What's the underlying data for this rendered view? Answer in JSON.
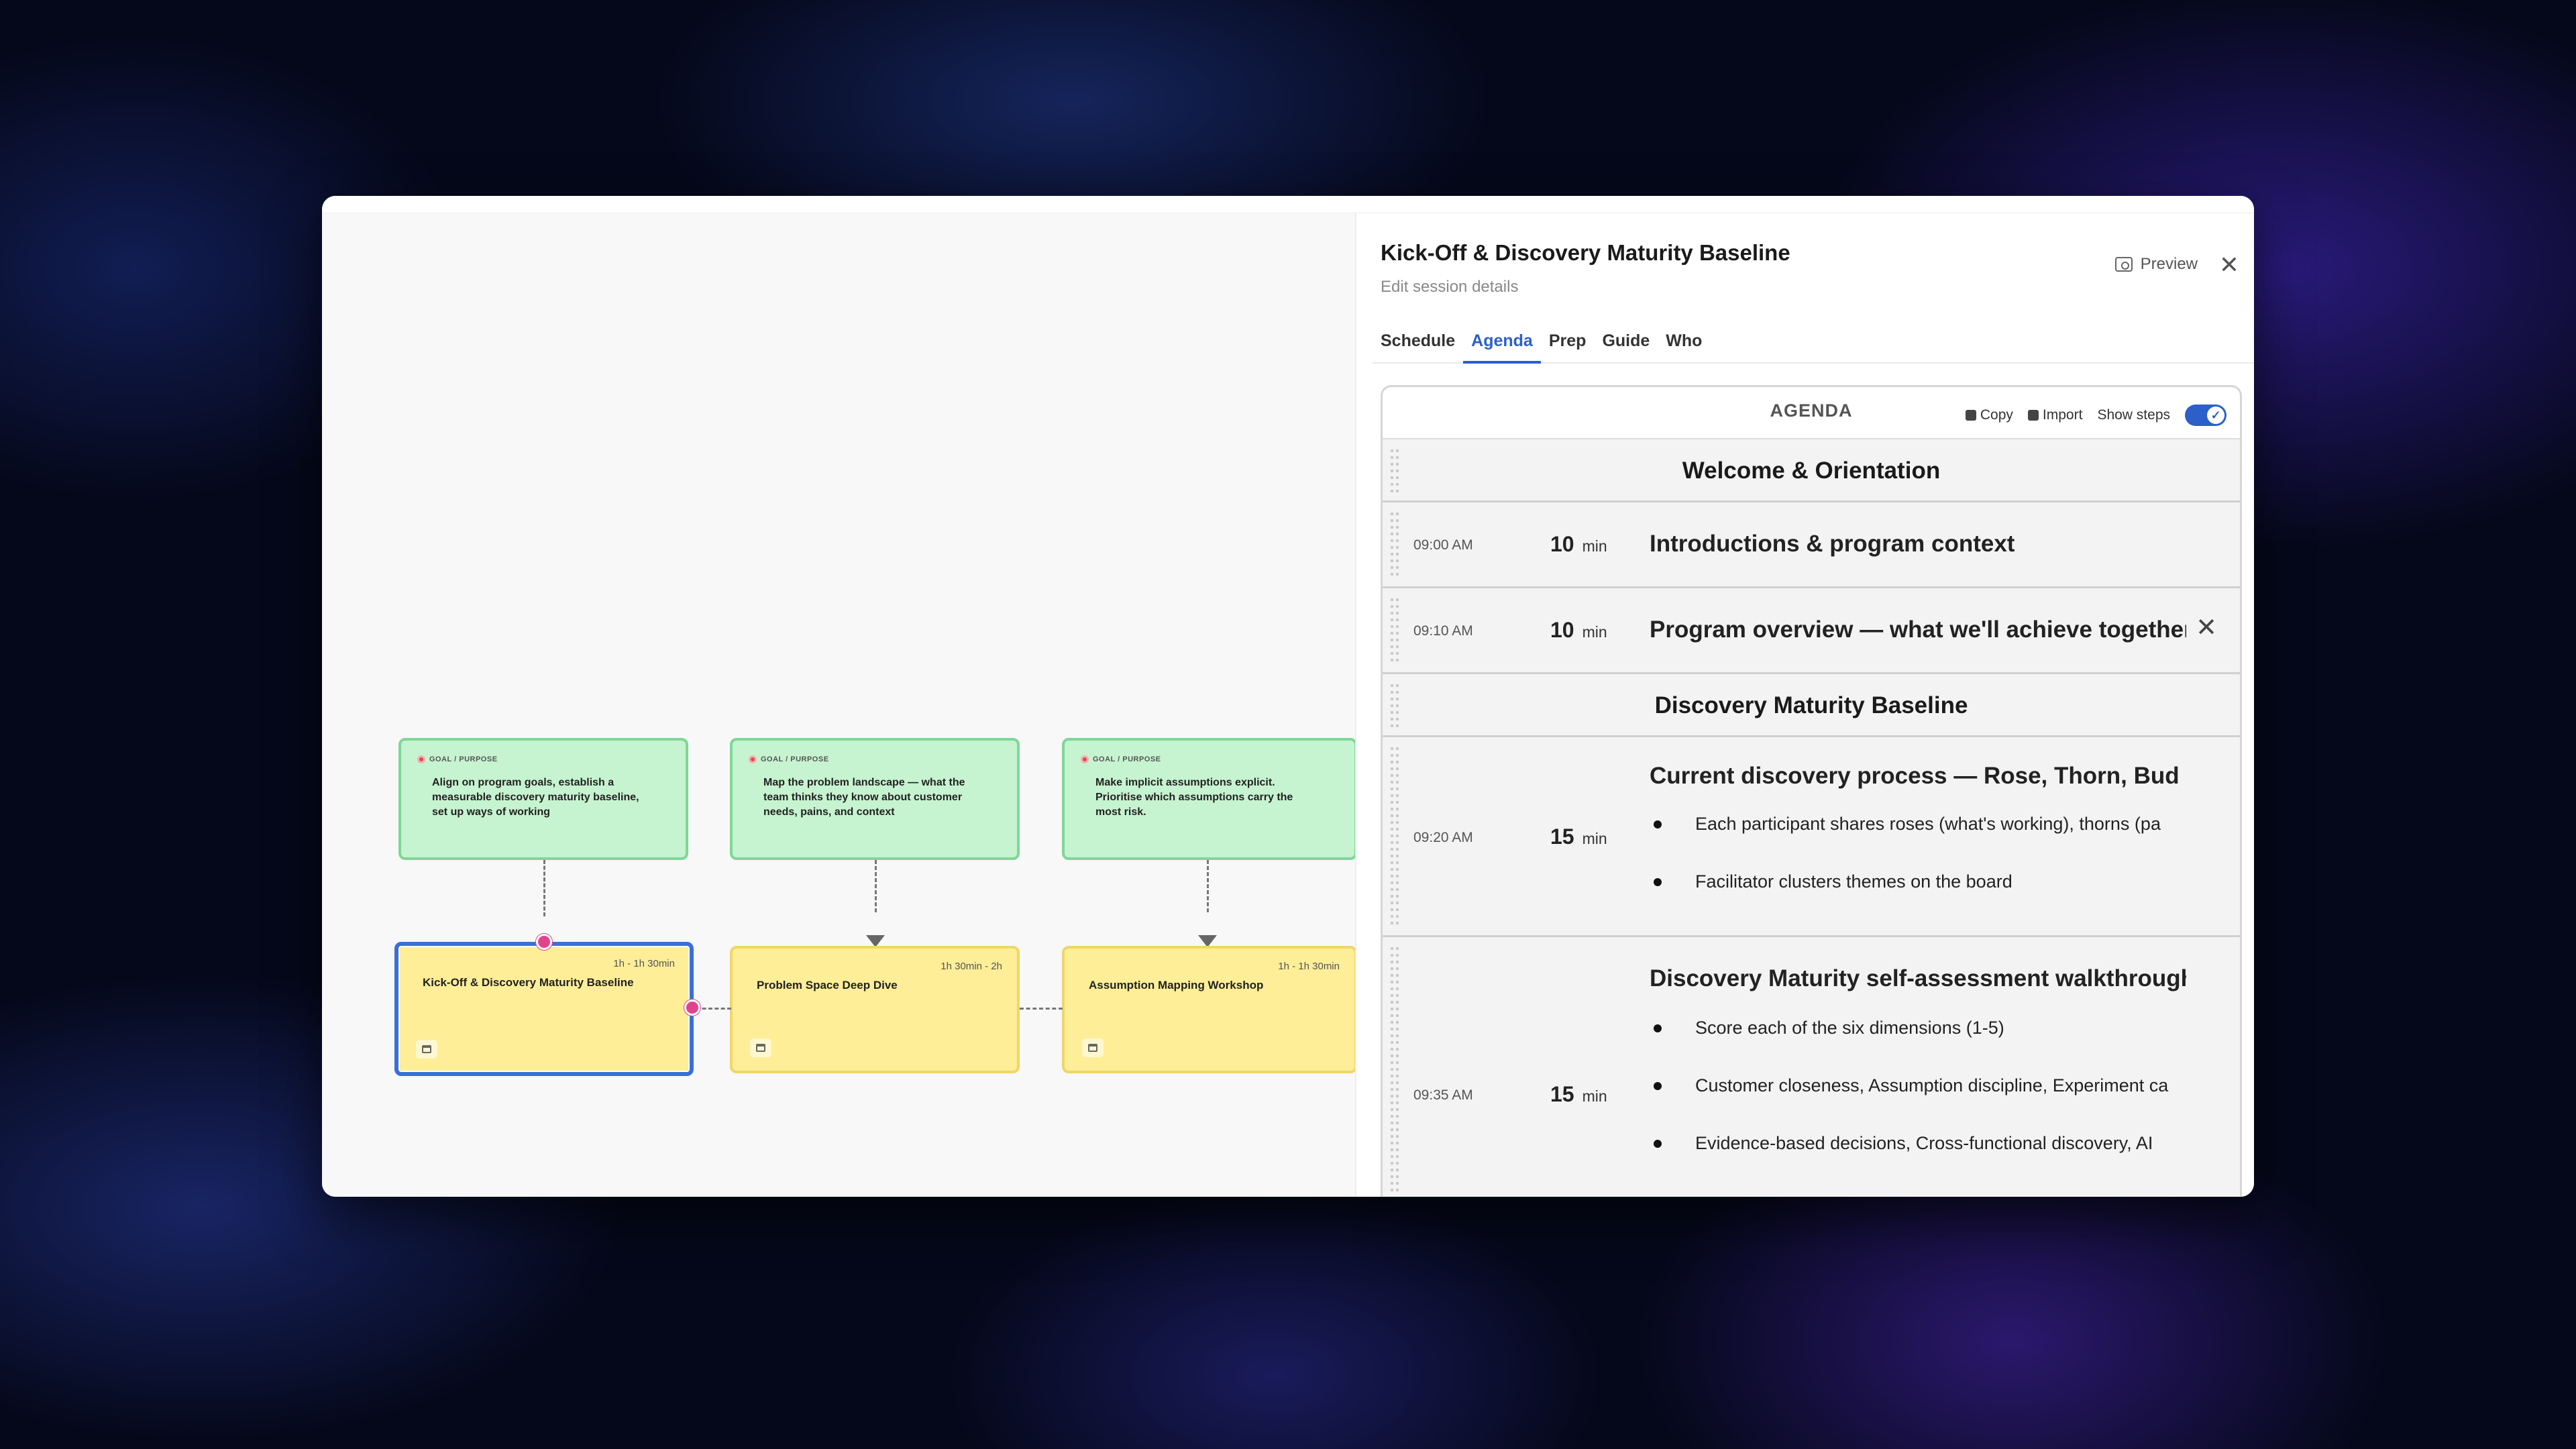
{
  "canvas": {
    "goals": [
      {
        "tag": "GOAL / PURPOSE",
        "text": "Align on program goals, establish a measurable discovery maturity baseline, set up ways of working"
      },
      {
        "tag": "GOAL / PURPOSE",
        "text": "Map the problem landscape — what the team thinks they know about customer needs, pains, and context"
      },
      {
        "tag": "GOAL / PURPOSE",
        "text": "Make implicit assumptions explicit. Prioritise which assumptions carry the most risk."
      }
    ],
    "sessions": [
      {
        "duration": "1h - 1h 30min",
        "title": "Kick-Off & Discovery Maturity Baseline"
      },
      {
        "duration": "1h 30min - 2h",
        "title": "Problem Space Deep Dive"
      },
      {
        "duration": "1h - 1h 30min",
        "title": "Assumption Mapping Workshop"
      }
    ]
  },
  "panel": {
    "title": "Kick-Off & Discovery Maturity Baseline",
    "subtitle": "Edit session details",
    "preview_label": "Preview",
    "close_label": "✕",
    "tabs": [
      "Schedule",
      "Agenda",
      "Prep",
      "Guide",
      "Who"
    ],
    "active_tab": "Agenda"
  },
  "agenda": {
    "title": "AGENDA",
    "copy_label": "Copy",
    "import_label": "Import",
    "show_steps_label": "Show steps",
    "show_steps_on": true,
    "sections": [
      "Welcome & Orientation",
      "Discovery Maturity Baseline"
    ],
    "items": [
      {
        "time": "09:00 AM",
        "duration": "10",
        "unit": "min",
        "title": "Introductions & program context",
        "bullets": []
      },
      {
        "time": "09:10 AM",
        "duration": "10",
        "unit": "min",
        "title": "Program overview — what we'll achieve together",
        "bullets": []
      },
      {
        "time": "09:20 AM",
        "duration": "15",
        "unit": "min",
        "title": "Current discovery process — Rose, Thorn, Bud",
        "bullets": [
          "Each participant shares roses (what's working), thorns (pa",
          "Facilitator clusters themes on the board"
        ]
      },
      {
        "time": "09:35 AM",
        "duration": "15",
        "unit": "min",
        "title": "Discovery Maturity self-assessment walkthrough",
        "bullets": [
          "Score each of the six dimensions (1-5)",
          "Customer closeness, Assumption discipline, Experiment ca",
          "Evidence-based decisions, Cross-functional discovery, AI"
        ]
      }
    ],
    "remove_label": "✕"
  },
  "colors": {
    "accent": "#2c60c8",
    "goal_bg": "#c6f3d0",
    "session_bg": "#fdee97",
    "connector_dot": "#e0458c"
  }
}
